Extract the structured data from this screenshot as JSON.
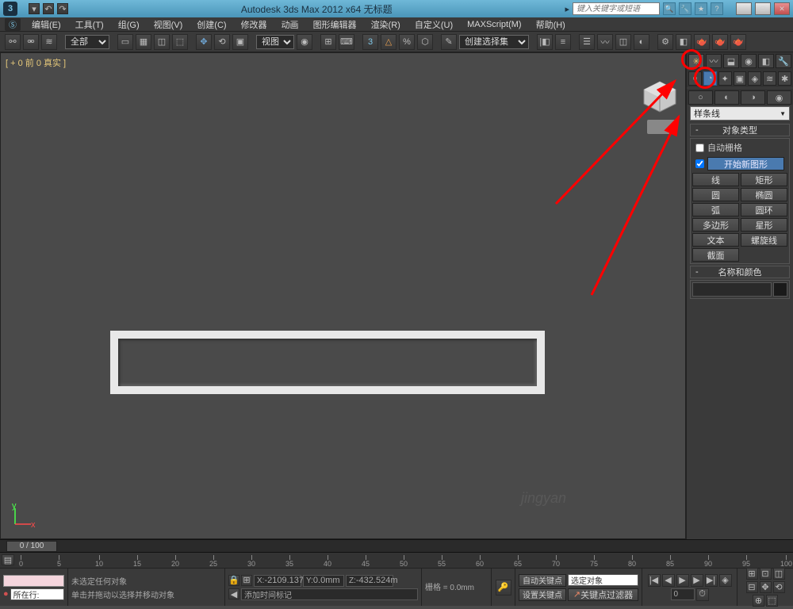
{
  "titlebar": {
    "title": "Autodesk 3ds Max 2012 x64   无标题",
    "search_placeholder": "键入关键字或短语"
  },
  "menus": [
    "编辑(E)",
    "工具(T)",
    "组(G)",
    "视图(V)",
    "创建(C)",
    "修改器",
    "动画",
    "图形编辑器",
    "渲染(R)",
    "自定义(U)",
    "MAXScript(M)",
    "帮助(H)"
  ],
  "toolbar": {
    "filter": "全部",
    "view": "视图",
    "dropdown": "创建选择集"
  },
  "viewport": {
    "label": "[ + 0 前 0 真实 ]"
  },
  "side": {
    "shape_dropdown": "样条线",
    "rollout1": "对象类型",
    "autogrid": "自动栅格",
    "startnew": "开始新图形",
    "buttons": [
      [
        "线",
        "矩形"
      ],
      [
        "圆",
        "椭圆"
      ],
      [
        "弧",
        "圆环"
      ],
      [
        "多边形",
        "星形"
      ],
      [
        "文本",
        "螺旋线"
      ],
      [
        "截面",
        ""
      ]
    ],
    "rollout2": "名称和颜色"
  },
  "timeline": {
    "range": "0 / 100",
    "ticks": [
      0,
      5,
      10,
      15,
      20,
      25,
      30,
      35,
      40,
      45,
      50,
      55,
      60,
      65,
      70,
      75,
      80,
      85,
      90,
      95,
      100
    ]
  },
  "status": {
    "none_selected": "未选定任何对象",
    "click_drag": "单击并拖动以选择并移动对象",
    "x": "-2109.137r",
    "y": "0.0mm",
    "z": "-432.524m",
    "grid": "栅格 = 0.0mm",
    "row": "所在行:",
    "auto_key": "自动关键点",
    "set_key": "设置关键点",
    "sel_obj": "选定对象",
    "key_filter": "关键点过滤器",
    "add_marker": "添加时间标记"
  },
  "watermark": "jingyan"
}
